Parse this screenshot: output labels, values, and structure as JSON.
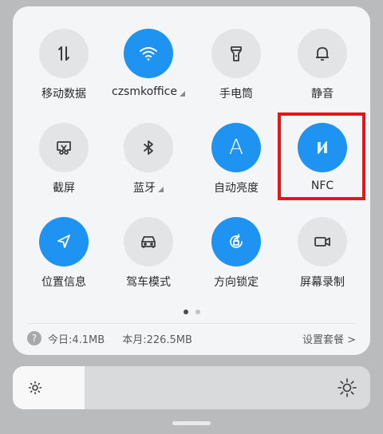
{
  "tiles": [
    {
      "label": "移动数据",
      "icon": "data-transfer-icon",
      "state": "off"
    },
    {
      "label": "czsmkoffice",
      "icon": "wifi-icon",
      "state": "on"
    },
    {
      "label": "手电筒",
      "icon": "flashlight-icon",
      "state": "off"
    },
    {
      "label": "静音",
      "icon": "bell-icon",
      "state": "off"
    },
    {
      "label": "截屏",
      "icon": "screenshot-icon",
      "state": "off"
    },
    {
      "label": "蓝牙",
      "icon": "bluetooth-icon",
      "state": "off"
    },
    {
      "label": "自动亮度",
      "icon": "auto-brightness-icon",
      "state": "on",
      "glyph": "A"
    },
    {
      "label": "NFC",
      "icon": "nfc-icon",
      "state": "on"
    },
    {
      "label": "位置信息",
      "icon": "location-icon",
      "state": "on"
    },
    {
      "label": "驾车模式",
      "icon": "car-icon",
      "state": "off"
    },
    {
      "label": "方向锁定",
      "icon": "rotation-lock-icon",
      "state": "on"
    },
    {
      "label": "屏幕录制",
      "icon": "video-icon",
      "state": "off"
    }
  ],
  "usage": {
    "help_glyph": "?",
    "today": "今日:4.1MB",
    "month": "本月:226.5MB",
    "settings": "设置套餐 >"
  },
  "pager": {
    "current": 1,
    "total": 2
  },
  "brightness": {
    "level": 0.2
  },
  "colors": {
    "accent": "#1f93f2",
    "highlight": "#e8141a",
    "tile_off": "#e3e4e6"
  }
}
